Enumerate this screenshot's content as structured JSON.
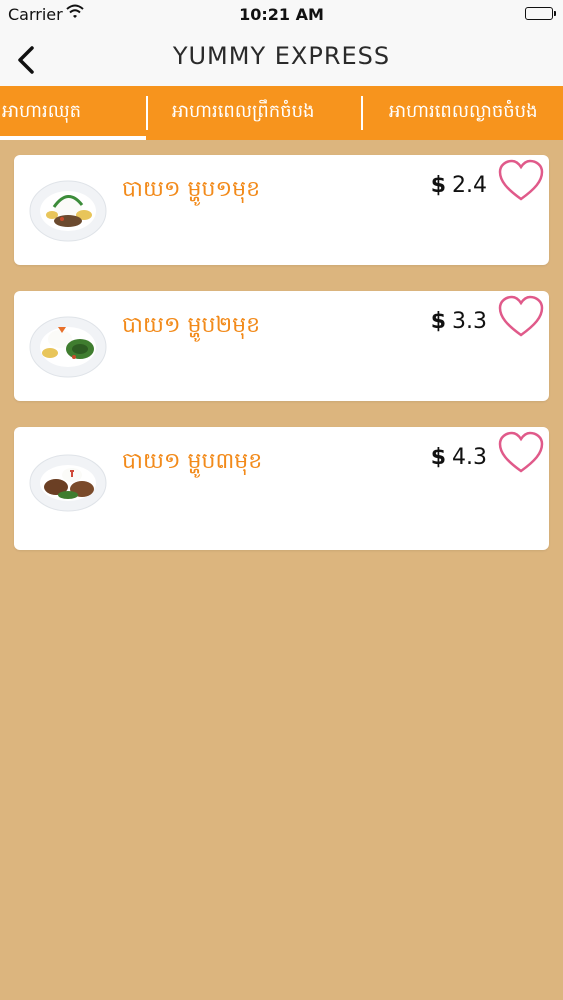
{
  "status_bar": {
    "carrier": "Carrier",
    "time": "10:21 AM"
  },
  "nav": {
    "title": "YUMMY EXPRESS",
    "back_icon": "chevron-left-icon"
  },
  "tabs": [
    {
      "label": "អាហារឈុត",
      "active": true
    },
    {
      "label": "អាហារពេលព្រឹកចំបង",
      "active": false
    },
    {
      "label": "អាហារពេលល្ងាចចំបង",
      "active": false
    }
  ],
  "menu_items": [
    {
      "name": "បាយ១ ម្ហូប១មុខ",
      "currency": "$",
      "price": "2.4",
      "favorite_icon": "heart-outline-icon"
    },
    {
      "name": "បាយ១ ម្ហូប២មុខ",
      "currency": "$",
      "price": "3.3",
      "favorite_icon": "heart-outline-icon"
    },
    {
      "name": "បាយ១ ម្ហូប៣មុខ",
      "currency": "$",
      "price": "4.3",
      "favorite_icon": "heart-outline-icon"
    }
  ],
  "colors": {
    "accent": "#f7941d",
    "background": "#dcb57e",
    "heart": "#e05a8a",
    "dish_name": "#f28a1a"
  }
}
